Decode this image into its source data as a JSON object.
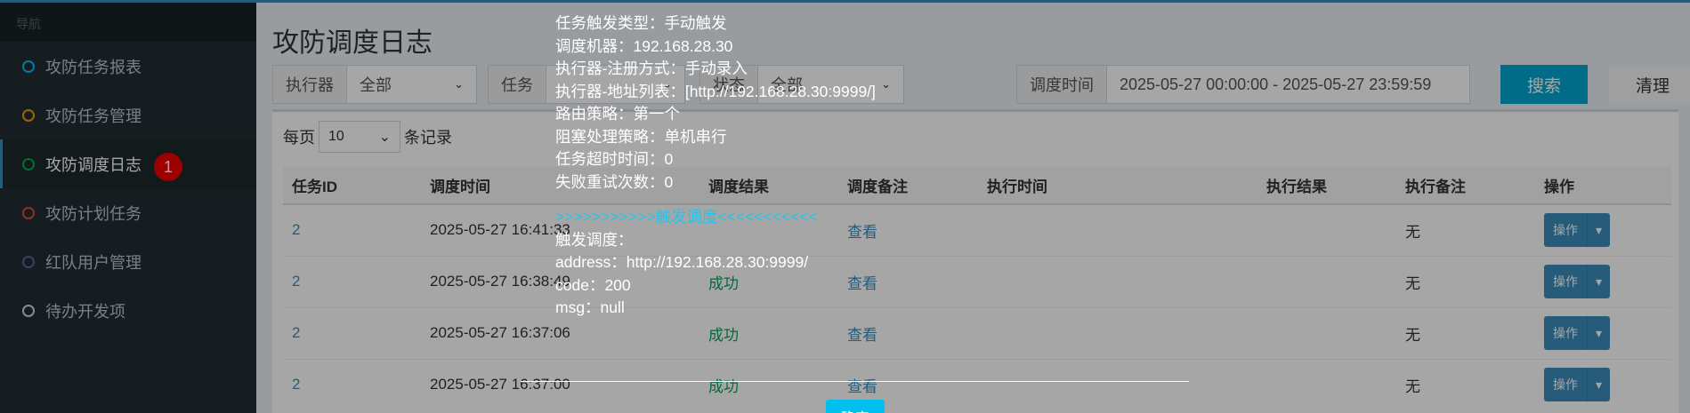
{
  "sidebar": {
    "header": "导航",
    "items": [
      {
        "label": "攻防任务报表",
        "color": "#00c0ef"
      },
      {
        "label": "攻防任务管理",
        "color": "#f39c12"
      },
      {
        "label": "攻防调度日志",
        "color": "#00a65a",
        "active": true,
        "badge": "1"
      },
      {
        "label": "攻防计划任务",
        "color": "#dd4b39"
      },
      {
        "label": "红队用户管理",
        "color": "#605ca8"
      },
      {
        "label": "待办开发项",
        "color": "#d2d6de"
      }
    ]
  },
  "page": {
    "title": "攻防调度日志"
  },
  "filters": {
    "executor_label": "执行器",
    "executor_value": "全部",
    "task_label": "任务",
    "status_label": "状态",
    "status_value": "全部",
    "time_label": "调度时间",
    "time_value": "2025-05-27 00:00:00 - 2025-05-27 23:59:59",
    "search": "搜索",
    "clear": "清理"
  },
  "list": {
    "per_page_prefix": "每页",
    "per_page_value": "10",
    "per_page_suffix": "条记录",
    "columns": [
      "任务ID",
      "调度时间",
      "调度结果",
      "调度备注",
      "执行时间",
      "执行结果",
      "执行备注",
      "操作"
    ],
    "rows": [
      {
        "id": "2",
        "time": "2025-05-27 16:41:33",
        "result": "",
        "remark": "查看",
        "exec_note": "无",
        "op": "操作"
      },
      {
        "id": "2",
        "time": "2025-05-27 16:38:49",
        "result": "成功",
        "remark": "查看",
        "exec_note": "无",
        "op": "操作"
      },
      {
        "id": "2",
        "time": "2025-05-27 16:37:06",
        "result": "成功",
        "remark": "查看",
        "exec_note": "无",
        "op": "操作"
      },
      {
        "id": "2",
        "time": "2025-05-27 16:37:00",
        "result": "成功",
        "remark": "查看",
        "exec_note": "无",
        "op": "操作"
      }
    ]
  },
  "tooltip": {
    "lines": [
      "任务触发类型：手动触发",
      "调度机器：192.168.28.30",
      "执行器-注册方式：手动录入",
      "执行器-地址列表：[http://192.168.28.30:9999/]",
      "路由策略：第一个",
      "阻塞处理策略：单机串行",
      "任务超时时间：0",
      "失败重试次数：0"
    ],
    "trigger_header": ">>>>>>>>>>>触发调度<<<<<<<<<<<",
    "trigger_lines": [
      "触发调度：",
      "address：http://192.168.28.30:9999/",
      "code：200",
      "msg：null"
    ],
    "confirm": "确定"
  }
}
